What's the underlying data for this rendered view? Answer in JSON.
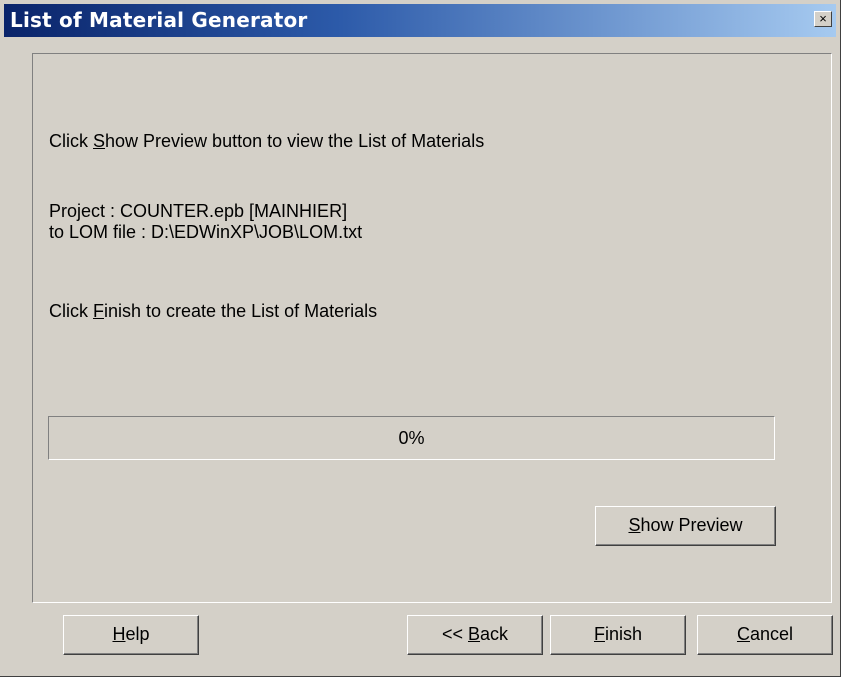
{
  "window": {
    "title": "List of Material Generator",
    "close_glyph": "×"
  },
  "content": {
    "instruction_preview": {
      "before": "Click ",
      "mnemonic": "S",
      "after": "how Preview button to view the List of Materials"
    },
    "project_line": "Project : COUNTER.epb [MAINHIER]",
    "lom_file_line": "to LOM file : D:\\EDWinXP\\JOB\\LOM.txt",
    "instruction_finish": {
      "before": "Click ",
      "mnemonic": "F",
      "after": "inish to create the List of Materials"
    }
  },
  "progress": {
    "value": 0,
    "label": "0%"
  },
  "buttons": {
    "show_preview": {
      "mnemonic": "S",
      "rest": "how Preview"
    },
    "help": {
      "mnemonic": "H",
      "rest": "elp"
    },
    "back": {
      "before": "<< ",
      "mnemonic": "B",
      "rest": "ack"
    },
    "finish": {
      "mnemonic": "F",
      "rest": "inish"
    },
    "cancel": {
      "mnemonic": "C",
      "rest": "ancel"
    }
  }
}
